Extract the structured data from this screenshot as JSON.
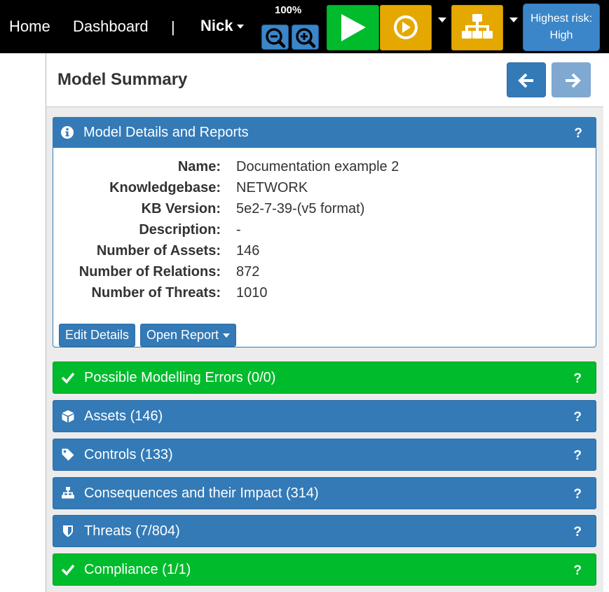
{
  "nav": {
    "home": "Home",
    "dashboard": "Dashboard",
    "separator": "|",
    "user": "Nick",
    "zoom": "100%",
    "risk_label": "Highest risk:",
    "risk_value": "High"
  },
  "summary": {
    "title": "Model Summary"
  },
  "details": {
    "title": "Model Details and Reports",
    "help": "?",
    "rows": [
      {
        "label": "Name:",
        "value": "Documentation example 2"
      },
      {
        "label": "Knowledgebase:",
        "value": "NETWORK"
      },
      {
        "label": "KB Version:",
        "value": "5e2-7-39-(v5 format)"
      },
      {
        "label": "Description:",
        "value": "-"
      },
      {
        "label": "Number of Assets:",
        "value": "146"
      },
      {
        "label": "Number of Relations:",
        "value": "872"
      },
      {
        "label": "Number of Threats:",
        "value": "1010"
      }
    ],
    "edit_button": "Edit Details",
    "report_button": "Open Report"
  },
  "panels": [
    {
      "title": "Possible Modelling Errors (0/0)",
      "icon": "check-icon",
      "color": "#00bb2c",
      "help": "?"
    },
    {
      "title": "Assets (146)",
      "icon": "cube-icon",
      "color": "#337ab7",
      "help": "?"
    },
    {
      "title": "Controls (133)",
      "icon": "tag-icon",
      "color": "#337ab7",
      "help": "?"
    },
    {
      "title": "Consequences and their Impact (314)",
      "icon": "sitemap-icon",
      "color": "#337ab7",
      "help": "?"
    },
    {
      "title": "Threats (7/804)",
      "icon": "shield-icon",
      "color": "#337ab7",
      "help": "?"
    },
    {
      "title": "Compliance (1/1)",
      "icon": "check-icon",
      "color": "#00bb2c",
      "help": "?"
    }
  ],
  "colors": {
    "navbar": "#000000",
    "primary": "#337ab7",
    "success": "#00bb2c",
    "validate": "#00bb2c",
    "calculate": "#e5a800",
    "layout": "#e5a800"
  }
}
